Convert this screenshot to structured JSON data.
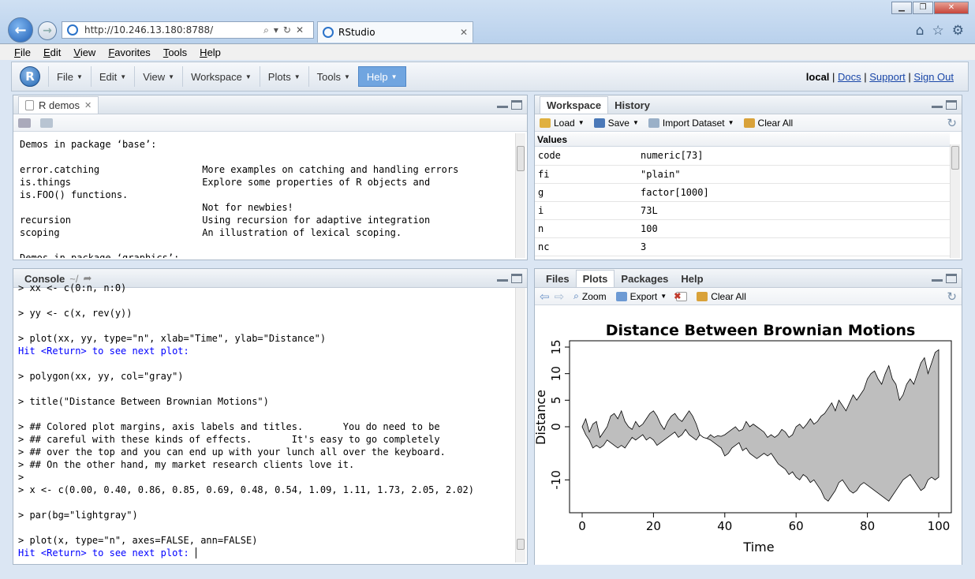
{
  "browser": {
    "url": "http://10.246.13.180:8788/",
    "tab_title": "RStudio",
    "menu": [
      "File",
      "Edit",
      "View",
      "Favorites",
      "Tools",
      "Help"
    ]
  },
  "rstudio_menu": [
    {
      "label": "File"
    },
    {
      "label": "Edit"
    },
    {
      "label": "View"
    },
    {
      "label": "Workspace"
    },
    {
      "label": "Plots"
    },
    {
      "label": "Tools"
    },
    {
      "label": "Help",
      "active": true
    }
  ],
  "user_links": {
    "user": "local",
    "docs": "Docs",
    "support": "Support",
    "sign_out": "Sign Out"
  },
  "source_pane": {
    "tab_label": "R demos",
    "content_lines": [
      "Demos in package ‘base’:",
      "",
      "error.catching                  More examples on catching and handling errors",
      "is.things                       Explore some properties of R objects and",
      "is.FOO() functions.",
      "                                Not for newbies!",
      "recursion                       Using recursion for adaptive integration",
      "scoping                         An illustration of lexical scoping.",
      "",
      "Demos in package ‘graphics’:"
    ]
  },
  "console": {
    "title": "Console",
    "path": "~/",
    "lines": [
      {
        "text": "> xx <- c(0:n, n:0)",
        "prompt": false
      },
      {
        "text": "",
        "prompt": false
      },
      {
        "text": "> yy <- c(x, rev(y))",
        "prompt": false
      },
      {
        "text": "",
        "prompt": false
      },
      {
        "text": "> plot(xx, yy, type=\"n\", xlab=\"Time\", ylab=\"Distance\")",
        "prompt": false
      },
      {
        "text": "Hit <Return> to see next plot:",
        "prompt": true
      },
      {
        "text": "",
        "prompt": false
      },
      {
        "text": "> polygon(xx, yy, col=\"gray\")",
        "prompt": false
      },
      {
        "text": "",
        "prompt": false
      },
      {
        "text": "> title(\"Distance Between Brownian Motions\")",
        "prompt": false
      },
      {
        "text": "",
        "prompt": false
      },
      {
        "text": "> ## Colored plot margins, axis labels and titles.       You do need to be",
        "prompt": false
      },
      {
        "text": "> ## careful with these kinds of effects.       It's easy to go completely",
        "prompt": false
      },
      {
        "text": "> ## over the top and you can end up with your lunch all over the keyboard.",
        "prompt": false
      },
      {
        "text": "> ## On the other hand, my market research clients love it.",
        "prompt": false
      },
      {
        "text": ">",
        "prompt": false
      },
      {
        "text": "> x <- c(0.00, 0.40, 0.86, 0.85, 0.69, 0.48, 0.54, 1.09, 1.11, 1.73, 2.05, 2.02)",
        "prompt": false
      },
      {
        "text": "",
        "prompt": false
      },
      {
        "text": "> par(bg=\"lightgray\")",
        "prompt": false
      },
      {
        "text": "",
        "prompt": false
      },
      {
        "text": "> plot(x, type=\"n\", axes=FALSE, ann=FALSE)",
        "prompt": false
      },
      {
        "text": "Hit <Return> to see next plot: ",
        "prompt": true
      }
    ]
  },
  "workspace": {
    "tabs": [
      "Workspace",
      "History"
    ],
    "toolbar": {
      "load": "Load",
      "save": "Save",
      "import": "Import Dataset",
      "clear": "Clear All"
    },
    "section": "Values",
    "rows": [
      {
        "name": "code",
        "value": "numeric[73]"
      },
      {
        "name": "fi",
        "value": "\"plain\""
      },
      {
        "name": "g",
        "value": "factor[1000]"
      },
      {
        "name": "i",
        "value": "73L"
      },
      {
        "name": "n",
        "value": "100"
      },
      {
        "name": "nc",
        "value": "3"
      }
    ]
  },
  "plots_pane": {
    "tabs": [
      "Files",
      "Plots",
      "Packages",
      "Help"
    ],
    "active_tab": "Plots",
    "toolbar": {
      "zoom": "Zoom",
      "export": "Export",
      "clear": "Clear All"
    }
  },
  "chart_data": {
    "type": "area",
    "title": "Distance Between Brownian Motions",
    "xlabel": "Time",
    "ylabel": "Distance",
    "xlim": [
      0,
      100
    ],
    "ylim": [
      -15,
      15
    ],
    "xticks": [
      0,
      20,
      40,
      60,
      80,
      100
    ],
    "yticks": [
      -10,
      0,
      5,
      10,
      15
    ],
    "ytick_labels": [
      "-10",
      "0",
      "5",
      "10",
      "15"
    ],
    "series": [
      {
        "values": [
          0,
          1.5,
          -1,
          0.5,
          1,
          -2,
          -1,
          0,
          2,
          2.5,
          1.5,
          3,
          1,
          0,
          -0.5,
          1,
          0,
          0.5,
          1.5,
          2.5,
          3,
          2,
          0.5,
          -0.5,
          1,
          2,
          2.5,
          1.5,
          1,
          2,
          3,
          2,
          0.5,
          -1.5,
          -2,
          -2.2,
          -1.5,
          -2,
          -1.7,
          -1.8,
          -1.5,
          -1,
          -0.5,
          0,
          -0.8,
          -0.5,
          1,
          0,
          0.5,
          0,
          -0.5,
          -1,
          -2,
          -1.5,
          -2,
          -1.5,
          -0.5,
          -1,
          -2,
          -1.5,
          0,
          0.5,
          -0.3,
          0.5,
          1.5,
          0.5,
          1,
          2,
          2.5,
          3.5,
          4.5,
          3,
          5,
          4,
          3,
          4.5,
          6,
          5,
          6,
          7,
          9,
          10,
          10.5,
          9,
          8,
          10,
          11.5,
          9,
          8,
          5,
          6,
          8,
          9,
          8,
          10,
          12,
          13,
          10,
          12,
          14,
          14.5
        ]
      },
      {
        "values": [
          0,
          -1.5,
          -2.5,
          -4,
          -3.5,
          -4,
          -3.5,
          -2.5,
          -3,
          -3.5,
          -4,
          -3.5,
          -4,
          -3,
          -2,
          -2.5,
          -2,
          -1.5,
          -2.5,
          -2,
          -2.5,
          -3.5,
          -3,
          -2.5,
          -2,
          -1.5,
          -1,
          -2,
          -1.5,
          -0.5,
          -1.5,
          -2,
          -2.5,
          -1.5,
          -2,
          -2.2,
          -2.5,
          -3,
          -3.5,
          -4,
          -5.5,
          -5,
          -4,
          -3.5,
          -3,
          -4.5,
          -4,
          -5,
          -5.5,
          -6,
          -5.5,
          -5,
          -5.5,
          -5,
          -6,
          -7,
          -7.5,
          -8,
          -9,
          -8.5,
          -9.5,
          -10,
          -9,
          -9.5,
          -10.5,
          -10,
          -11,
          -12,
          -13.5,
          -14,
          -13,
          -12,
          -10.5,
          -10,
          -11,
          -12,
          -12.5,
          -12,
          -11,
          -10.5,
          -11,
          -11.5,
          -12,
          -12.5,
          -13,
          -13.5,
          -14,
          -13,
          -12,
          -11,
          -10,
          -9.5,
          -9,
          -10,
          -11,
          -12,
          -11.5,
          -10,
          -9.5,
          -10,
          -9.5
        ]
      }
    ]
  }
}
